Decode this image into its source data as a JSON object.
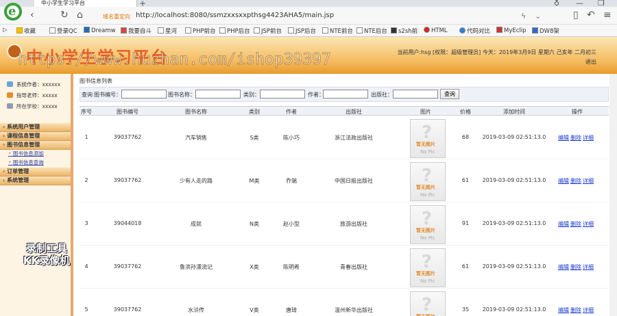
{
  "browser": {
    "tab_title": "中小学生学习平台",
    "url_tag": "域名重定向",
    "url": "http://localhost:8080/ssmzxxsxxpthsg4423AHA5/main.jsp",
    "bookmarks": [
      "收藏",
      "登录QC",
      "Dreamw",
      "我要自斗",
      "星河",
      "PHP前台",
      "PHP后台",
      "JSP前台",
      "JSP后台",
      "NTE前台",
      "NTE后台",
      "s2sh前",
      "HTML",
      "代码对比",
      "MyEclip",
      "DW8架"
    ]
  },
  "header": {
    "title": "中小学生学习平台",
    "watermark": "https://www.huzhan.com/ishop39397",
    "user_info_line1": "当前用户:hsg [权限：超级管理员] 今天：2019年3月9日 星期六 己亥年 二月初三",
    "user_info_line2": "退出"
  },
  "sidebar": {
    "info": [
      {
        "label": "系统作者：xxxxxx",
        "color": "#6aa3d8"
      },
      {
        "label": "指导老师：xxxxx",
        "color": "#e58c2e"
      },
      {
        "label": "所在学校：xxxxx",
        "color": "#8e9ab0"
      }
    ],
    "menu": [
      {
        "label": "系统用户管理",
        "sub": []
      },
      {
        "label": "课程信息管理",
        "sub": []
      },
      {
        "label": "图书信息管理",
        "sub": [
          "图书信息添加",
          "图书信息查询"
        ]
      },
      {
        "label": "订单管理",
        "sub": []
      },
      {
        "label": "系统管理",
        "sub": []
      }
    ],
    "rec_watermark": [
      "录制工具",
      "KK录像机"
    ]
  },
  "main": {
    "page_title": "图书信息列表",
    "search": {
      "prefix": "查询",
      "fields": [
        "图书编号：",
        "图书名称：",
        "类别：",
        "作者：",
        "出版社："
      ],
      "button": "查询"
    },
    "columns": [
      "序号",
      "图书编号",
      "图书名称",
      "类别",
      "作者",
      "出版社",
      "图片",
      "价格",
      "添加时间",
      "操作"
    ],
    "no_pic_text_cn": "暂无图片",
    "no_pic_text_en": "No Pic",
    "actions": [
      "编辑",
      "删除",
      "详细"
    ],
    "rows": [
      {
        "no": "1",
        "code": "39037762",
        "name": "汽车销售",
        "type": "S类",
        "author": "陈小巧",
        "publisher": "浙江法政出版社",
        "price": "68",
        "time": "2019-03-09 02:51:13.0"
      },
      {
        "no": "2",
        "code": "39037762",
        "name": "少有人走的路",
        "type": "M类",
        "author": "乔端",
        "publisher": "中国日报出版社",
        "price": "61",
        "time": "2019-03-09 02:51:13.0"
      },
      {
        "no": "3",
        "code": "39044018",
        "name": "成就",
        "type": "N类",
        "author": "赵小型",
        "publisher": "旅游出版社",
        "price": "91",
        "time": "2019-03-09 02:51:13.0"
      },
      {
        "no": "4",
        "code": "39037762",
        "name": "鲁滨孙漂流记",
        "type": "X类",
        "author": "陈明希",
        "publisher": "青春出版社",
        "price": "61",
        "time": "2019-03-09 02:51:13.0"
      },
      {
        "no": "5",
        "code": "39037762",
        "name": "水浒传",
        "type": "V类",
        "author": "唐琦",
        "publisher": "温州新华出版社",
        "price": "35",
        "time": "2019-03-09 02:51:13.0"
      }
    ]
  }
}
